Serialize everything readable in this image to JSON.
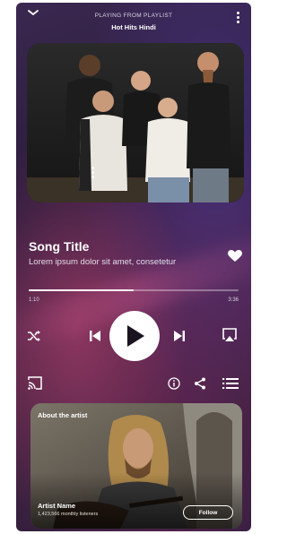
{
  "header": {
    "playing_from": "PLAYING FROM PLAYLIST",
    "playlist_name": "Hot Hits Hindi"
  },
  "song": {
    "title": "Song Title",
    "subtitle": "Lorem ipsum dolor sit amet, consetetur"
  },
  "progress": {
    "elapsed": "1:10",
    "duration": "3:36",
    "fraction": 0.5
  },
  "artist_card": {
    "label": "About the artist",
    "name": "Artist Name",
    "meta": "1,423,566 monthly listeners",
    "follow_label": "Follow"
  },
  "icons": {
    "collapse": "chevron-down-icon",
    "more": "more-vertical-icon",
    "like": "heart-icon",
    "shuffle": "shuffle-icon",
    "previous": "skip-previous-icon",
    "play": "play-icon",
    "next": "skip-next-icon",
    "airplay": "airplay-icon",
    "cast": "cast-icon",
    "info": "info-icon",
    "share": "share-icon",
    "queue": "queue-list-icon"
  },
  "colors": {
    "accent": "#ffffff",
    "background_dark": "#2b1b3b",
    "background_magenta": "#4a2240"
  }
}
